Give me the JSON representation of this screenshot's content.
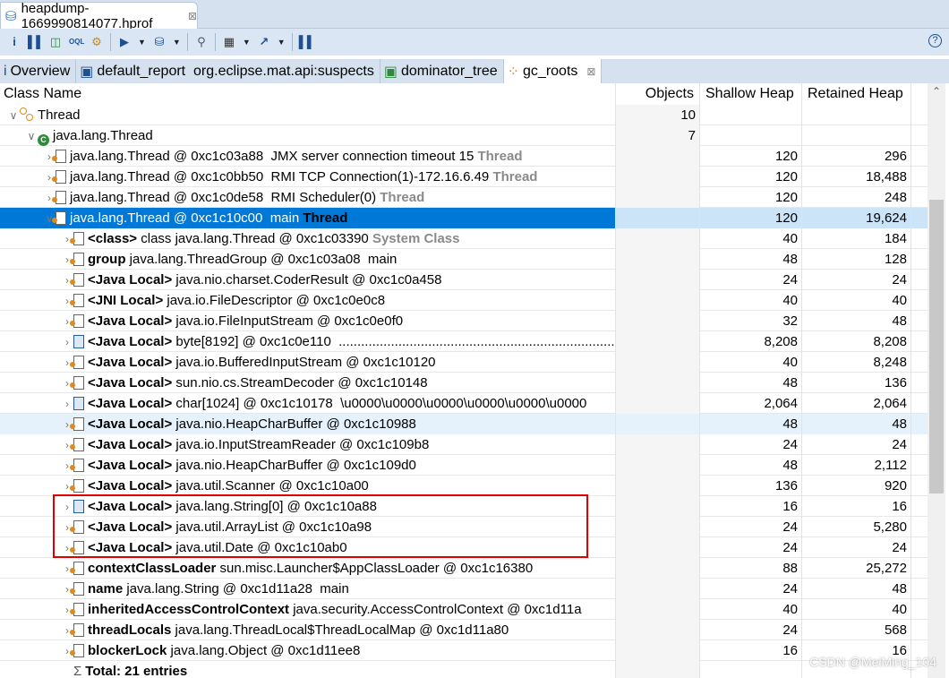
{
  "editor_tab": {
    "title": "heapdump-1669990814077.hprof",
    "icon": "database-icon"
  },
  "toolbar": {
    "buttons": [
      "info-icon",
      "histogram-icon",
      "dominator-tree-icon",
      "oql-icon",
      "gear-icon",
      "query-browser-icon",
      "heap-dump-overview-icon",
      "search-icon",
      "calculator-icon",
      "export-icon",
      "leak-suspects-icon"
    ],
    "help": "?"
  },
  "query_tabs": [
    {
      "label": "Overview",
      "icon": "info-icon"
    },
    {
      "label": "default_report  org.eclipse.mat.api:suspects",
      "icon": "report-icon"
    },
    {
      "label": "dominator_tree",
      "icon": "dominator-tree-icon"
    },
    {
      "label": "gc_roots",
      "icon": "gc-roots-icon",
      "active": true
    }
  ],
  "columns": [
    "Class Name",
    "Objects",
    "Shallow Heap",
    "Retained Heap"
  ],
  "rows": [
    {
      "lvl": 0,
      "exp": "v",
      "icon": "grp",
      "pre": "",
      "text": "Thread",
      "suf": "",
      "o": "10",
      "s": "",
      "r": ""
    },
    {
      "lvl": 1,
      "exp": "v",
      "icon": "cls",
      "pre": "",
      "text": "java.lang.Thread",
      "suf": "",
      "o": "7",
      "s": "",
      "r": ""
    },
    {
      "lvl": 2,
      "exp": ">",
      "icon": "obj",
      "pre": "",
      "text": "java.lang.Thread @ 0xc1c03a88  JMX server connection timeout 15 ",
      "suf": "Thread",
      "o": "",
      "s": "120",
      "r": "296"
    },
    {
      "lvl": 2,
      "exp": ">",
      "icon": "obj",
      "pre": "",
      "text": "java.lang.Thread @ 0xc1c0bb50  RMI TCP Connection(1)-172.16.6.49 ",
      "suf": "Thread",
      "o": "",
      "s": "120",
      "r": "18,488"
    },
    {
      "lvl": 2,
      "exp": ">",
      "icon": "obj",
      "pre": "",
      "text": "java.lang.Thread @ 0xc1c0de58  RMI Scheduler(0) ",
      "suf": "Thread",
      "o": "",
      "s": "120",
      "r": "248"
    },
    {
      "lvl": 2,
      "exp": "v",
      "icon": "obj",
      "pre": "",
      "text": "java.lang.Thread @ 0xc1c10c00  main ",
      "suf": "Thread",
      "o": "",
      "s": "120",
      "r": "19,624",
      "selected": true
    },
    {
      "lvl": 3,
      "exp": ">",
      "icon": "obj",
      "pre": "<class>",
      "text": " class java.lang.Thread @ 0xc1c03390 ",
      "suf": "System Class",
      "o": "",
      "s": "40",
      "r": "184"
    },
    {
      "lvl": 3,
      "exp": ">",
      "icon": "obj",
      "pre": "group",
      "text": " java.lang.ThreadGroup @ 0xc1c03a08  main",
      "suf": "",
      "o": "",
      "s": "48",
      "r": "128"
    },
    {
      "lvl": 3,
      "exp": ">",
      "icon": "obj",
      "pre": "<Java Local>",
      "text": " java.nio.charset.CoderResult @ 0xc1c0a458",
      "suf": "",
      "o": "",
      "s": "24",
      "r": "24"
    },
    {
      "lvl": 3,
      "exp": ">",
      "icon": "obj",
      "pre": "<JNI Local>",
      "text": " java.io.FileDescriptor @ 0xc1c0e0c8",
      "suf": "",
      "o": "",
      "s": "40",
      "r": "40"
    },
    {
      "lvl": 3,
      "exp": ">",
      "icon": "obj",
      "pre": "<Java Local>",
      "text": " java.io.FileInputStream @ 0xc1c0e0f0",
      "suf": "",
      "o": "",
      "s": "32",
      "r": "48"
    },
    {
      "lvl": 3,
      "exp": ">",
      "icon": "arr",
      "pre": "<Java Local>",
      "text": " byte[8192] @ 0xc1c0e110  ............................................................................................",
      "suf": "",
      "o": "",
      "s": "8,208",
      "r": "8,208"
    },
    {
      "lvl": 3,
      "exp": ">",
      "icon": "obj",
      "pre": "<Java Local>",
      "text": " java.io.BufferedInputStream @ 0xc1c10120",
      "suf": "",
      "o": "",
      "s": "40",
      "r": "8,248"
    },
    {
      "lvl": 3,
      "exp": ">",
      "icon": "obj",
      "pre": "<Java Local>",
      "text": " sun.nio.cs.StreamDecoder @ 0xc1c10148",
      "suf": "",
      "o": "",
      "s": "48",
      "r": "136"
    },
    {
      "lvl": 3,
      "exp": ">",
      "icon": "arr",
      "pre": "<Java Local>",
      "text": " char[1024] @ 0xc1c10178  \\u0000\\u0000\\u0000\\u0000\\u0000\\u0000",
      "suf": "",
      "o": "",
      "s": "2,064",
      "r": "2,064"
    },
    {
      "lvl": 3,
      "exp": ">",
      "icon": "obj",
      "pre": "<Java Local>",
      "text": " java.nio.HeapCharBuffer @ 0xc1c10988",
      "suf": "",
      "o": "",
      "s": "48",
      "r": "48",
      "hover": true
    },
    {
      "lvl": 3,
      "exp": ">",
      "icon": "obj",
      "pre": "<Java Local>",
      "text": " java.io.InputStreamReader @ 0xc1c109b8",
      "suf": "",
      "o": "",
      "s": "24",
      "r": "24"
    },
    {
      "lvl": 3,
      "exp": ">",
      "icon": "obj",
      "pre": "<Java Local>",
      "text": " java.nio.HeapCharBuffer @ 0xc1c109d0",
      "suf": "",
      "o": "",
      "s": "48",
      "r": "2,112"
    },
    {
      "lvl": 3,
      "exp": ">",
      "icon": "obj",
      "pre": "<Java Local>",
      "text": " java.util.Scanner @ 0xc1c10a00",
      "suf": "",
      "o": "",
      "s": "136",
      "r": "920"
    },
    {
      "lvl": 3,
      "exp": ">",
      "icon": "arr",
      "pre": "<Java Local>",
      "text": " java.lang.String[0] @ 0xc1c10a88",
      "suf": "",
      "o": "",
      "s": "16",
      "r": "16"
    },
    {
      "lvl": 3,
      "exp": ">",
      "icon": "obj",
      "pre": "<Java Local>",
      "text": " java.util.ArrayList @ 0xc1c10a98",
      "suf": "",
      "o": "",
      "s": "24",
      "r": "5,280"
    },
    {
      "lvl": 3,
      "exp": ">",
      "icon": "obj",
      "pre": "<Java Local>",
      "text": " java.util.Date @ 0xc1c10ab0",
      "suf": "",
      "o": "",
      "s": "24",
      "r": "24"
    },
    {
      "lvl": 3,
      "exp": ">",
      "icon": "obj",
      "pre": "contextClassLoader",
      "text": " sun.misc.Launcher$AppClassLoader @ 0xc1c16380",
      "suf": "",
      "o": "",
      "s": "88",
      "r": "25,272"
    },
    {
      "lvl": 3,
      "exp": ">",
      "icon": "obj",
      "pre": "name",
      "text": " java.lang.String @ 0xc1d11a28  main",
      "suf": "",
      "o": "",
      "s": "24",
      "r": "48"
    },
    {
      "lvl": 3,
      "exp": ">",
      "icon": "obj",
      "pre": "inheritedAccessControlContext",
      "text": " java.security.AccessControlContext @ 0xc1d11a",
      "suf": "",
      "o": "",
      "s": "40",
      "r": "40"
    },
    {
      "lvl": 3,
      "exp": ">",
      "icon": "obj",
      "pre": "threadLocals",
      "text": " java.lang.ThreadLocal$ThreadLocalMap @ 0xc1d11a80",
      "suf": "",
      "o": "",
      "s": "24",
      "r": "568"
    },
    {
      "lvl": 3,
      "exp": ">",
      "icon": "obj",
      "pre": "blockerLock",
      "text": " java.lang.Object @ 0xc1d11ee8",
      "suf": "",
      "o": "",
      "s": "16",
      "r": "16"
    },
    {
      "lvl": 3,
      "exp": "",
      "icon": "sum",
      "pre": "Total: 21 entries",
      "text": "",
      "suf": "",
      "o": "",
      "s": "",
      "r": ""
    }
  ],
  "watermark": "CSDN @MeiMing_104"
}
